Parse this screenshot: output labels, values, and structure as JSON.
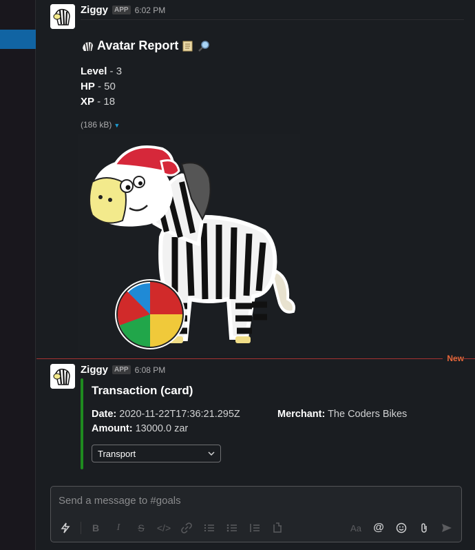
{
  "message1": {
    "sender": "Ziggy",
    "badge": "APP",
    "time": "6:02 PM",
    "title": "Avatar Report",
    "stats": [
      {
        "label": "Level",
        "value": " - 3"
      },
      {
        "label": "HP",
        "value": " - 50"
      },
      {
        "label": "XP",
        "value": " - 18"
      }
    ],
    "file_size": "(186 kB)"
  },
  "divider": {
    "label": "New"
  },
  "message2": {
    "sender": "Ziggy",
    "badge": "APP",
    "time": "6:08 PM",
    "title": "Transaction (card)",
    "date_label": "Date:",
    "date_value": " 2020-11-22T17:36:21.295Z",
    "merchant_label": "Merchant:",
    "merchant_value": " The Coders Bikes",
    "amount_label": "Amount:",
    "amount_value": " 13000.0 zar",
    "category_selected": "Transport",
    "accent_color": "#1f8a1f"
  },
  "composer": {
    "placeholder": "Send a message to #goals",
    "tools": [
      "shortcuts-icon",
      "bold-icon",
      "italic-icon",
      "strikethrough-icon",
      "code-icon",
      "link-icon",
      "ordered-list-icon",
      "bulleted-list-icon",
      "blockquote-icon",
      "code-block-icon",
      "formatting-icon",
      "mention-icon",
      "emoji-icon",
      "attach-icon",
      "send-icon"
    ]
  }
}
